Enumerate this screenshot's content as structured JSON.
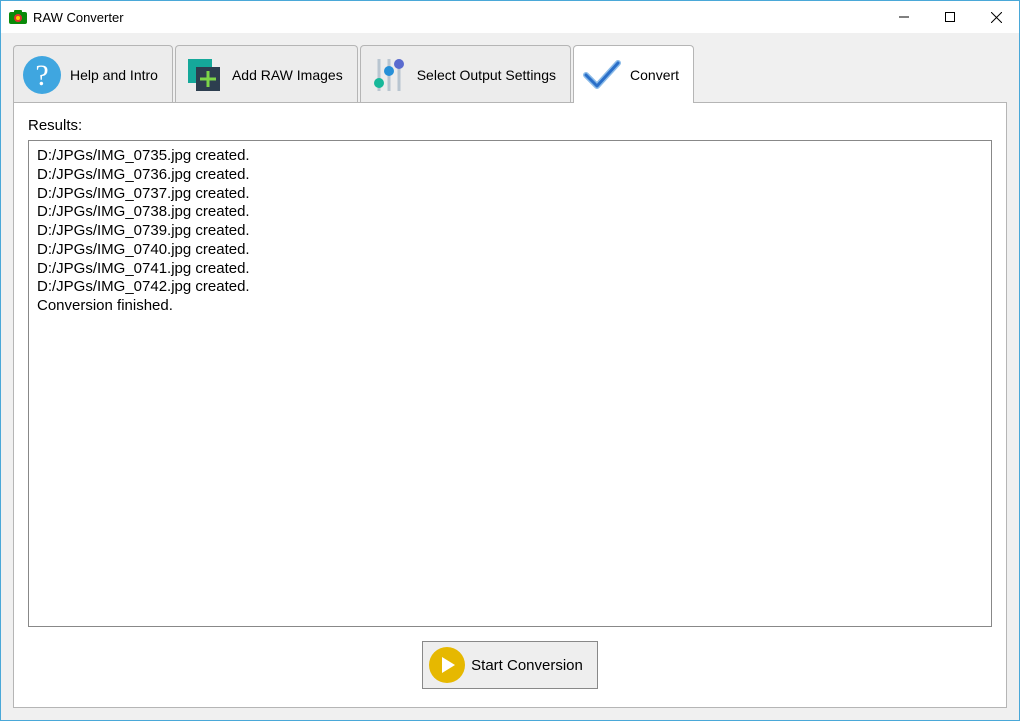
{
  "window": {
    "title": "RAW Converter"
  },
  "tabs": {
    "help": "Help and Intro",
    "add": "Add RAW Images",
    "settings": "Select Output Settings",
    "convert": "Convert"
  },
  "results": {
    "label": "Results:",
    "lines": [
      "D:/JPGs/IMG_0735.jpg created.",
      "D:/JPGs/IMG_0736.jpg created.",
      "D:/JPGs/IMG_0737.jpg created.",
      "D:/JPGs/IMG_0738.jpg created.",
      "D:/JPGs/IMG_0739.jpg created.",
      "D:/JPGs/IMG_0740.jpg created.",
      "D:/JPGs/IMG_0741.jpg created.",
      "D:/JPGs/IMG_0742.jpg created.",
      "Conversion finished."
    ]
  },
  "buttons": {
    "start": "Start Conversion"
  }
}
